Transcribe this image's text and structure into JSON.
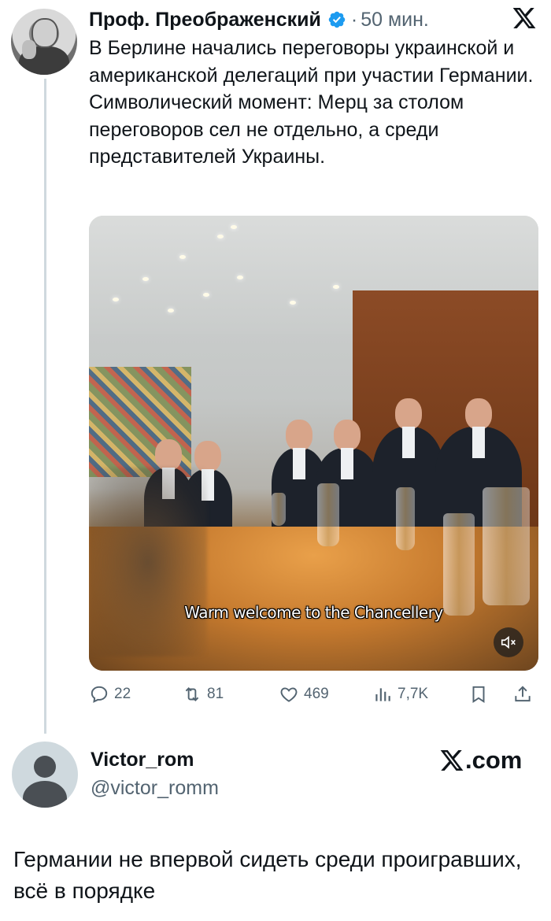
{
  "tweet": {
    "author": "Проф. Преображенский",
    "separator": "·",
    "time": "50 мин.",
    "verified_icon": "verified-badge-icon",
    "text_lines": [
      "В Берлине начались переговоры украинской и американской делегаций при участии Германии.",
      "Символический момент: Мерц за столом переговоров сел не отдельно, а среди представителей Украины."
    ],
    "video_caption": "Warm welcome to the Chancellery",
    "stats": {
      "replies": "22",
      "reposts": "81",
      "likes": "469",
      "views": "7,7K"
    }
  },
  "reply": {
    "name": "Victor_rom",
    "handle": "@victor_romm",
    "brand": ".com",
    "text": "Германии не впервой сидеть среди проигравших, всё в порядке"
  },
  "colors": {
    "accent": "#1d9bf0",
    "secondary_text": "#536471",
    "thread_line": "#cfd9de"
  }
}
